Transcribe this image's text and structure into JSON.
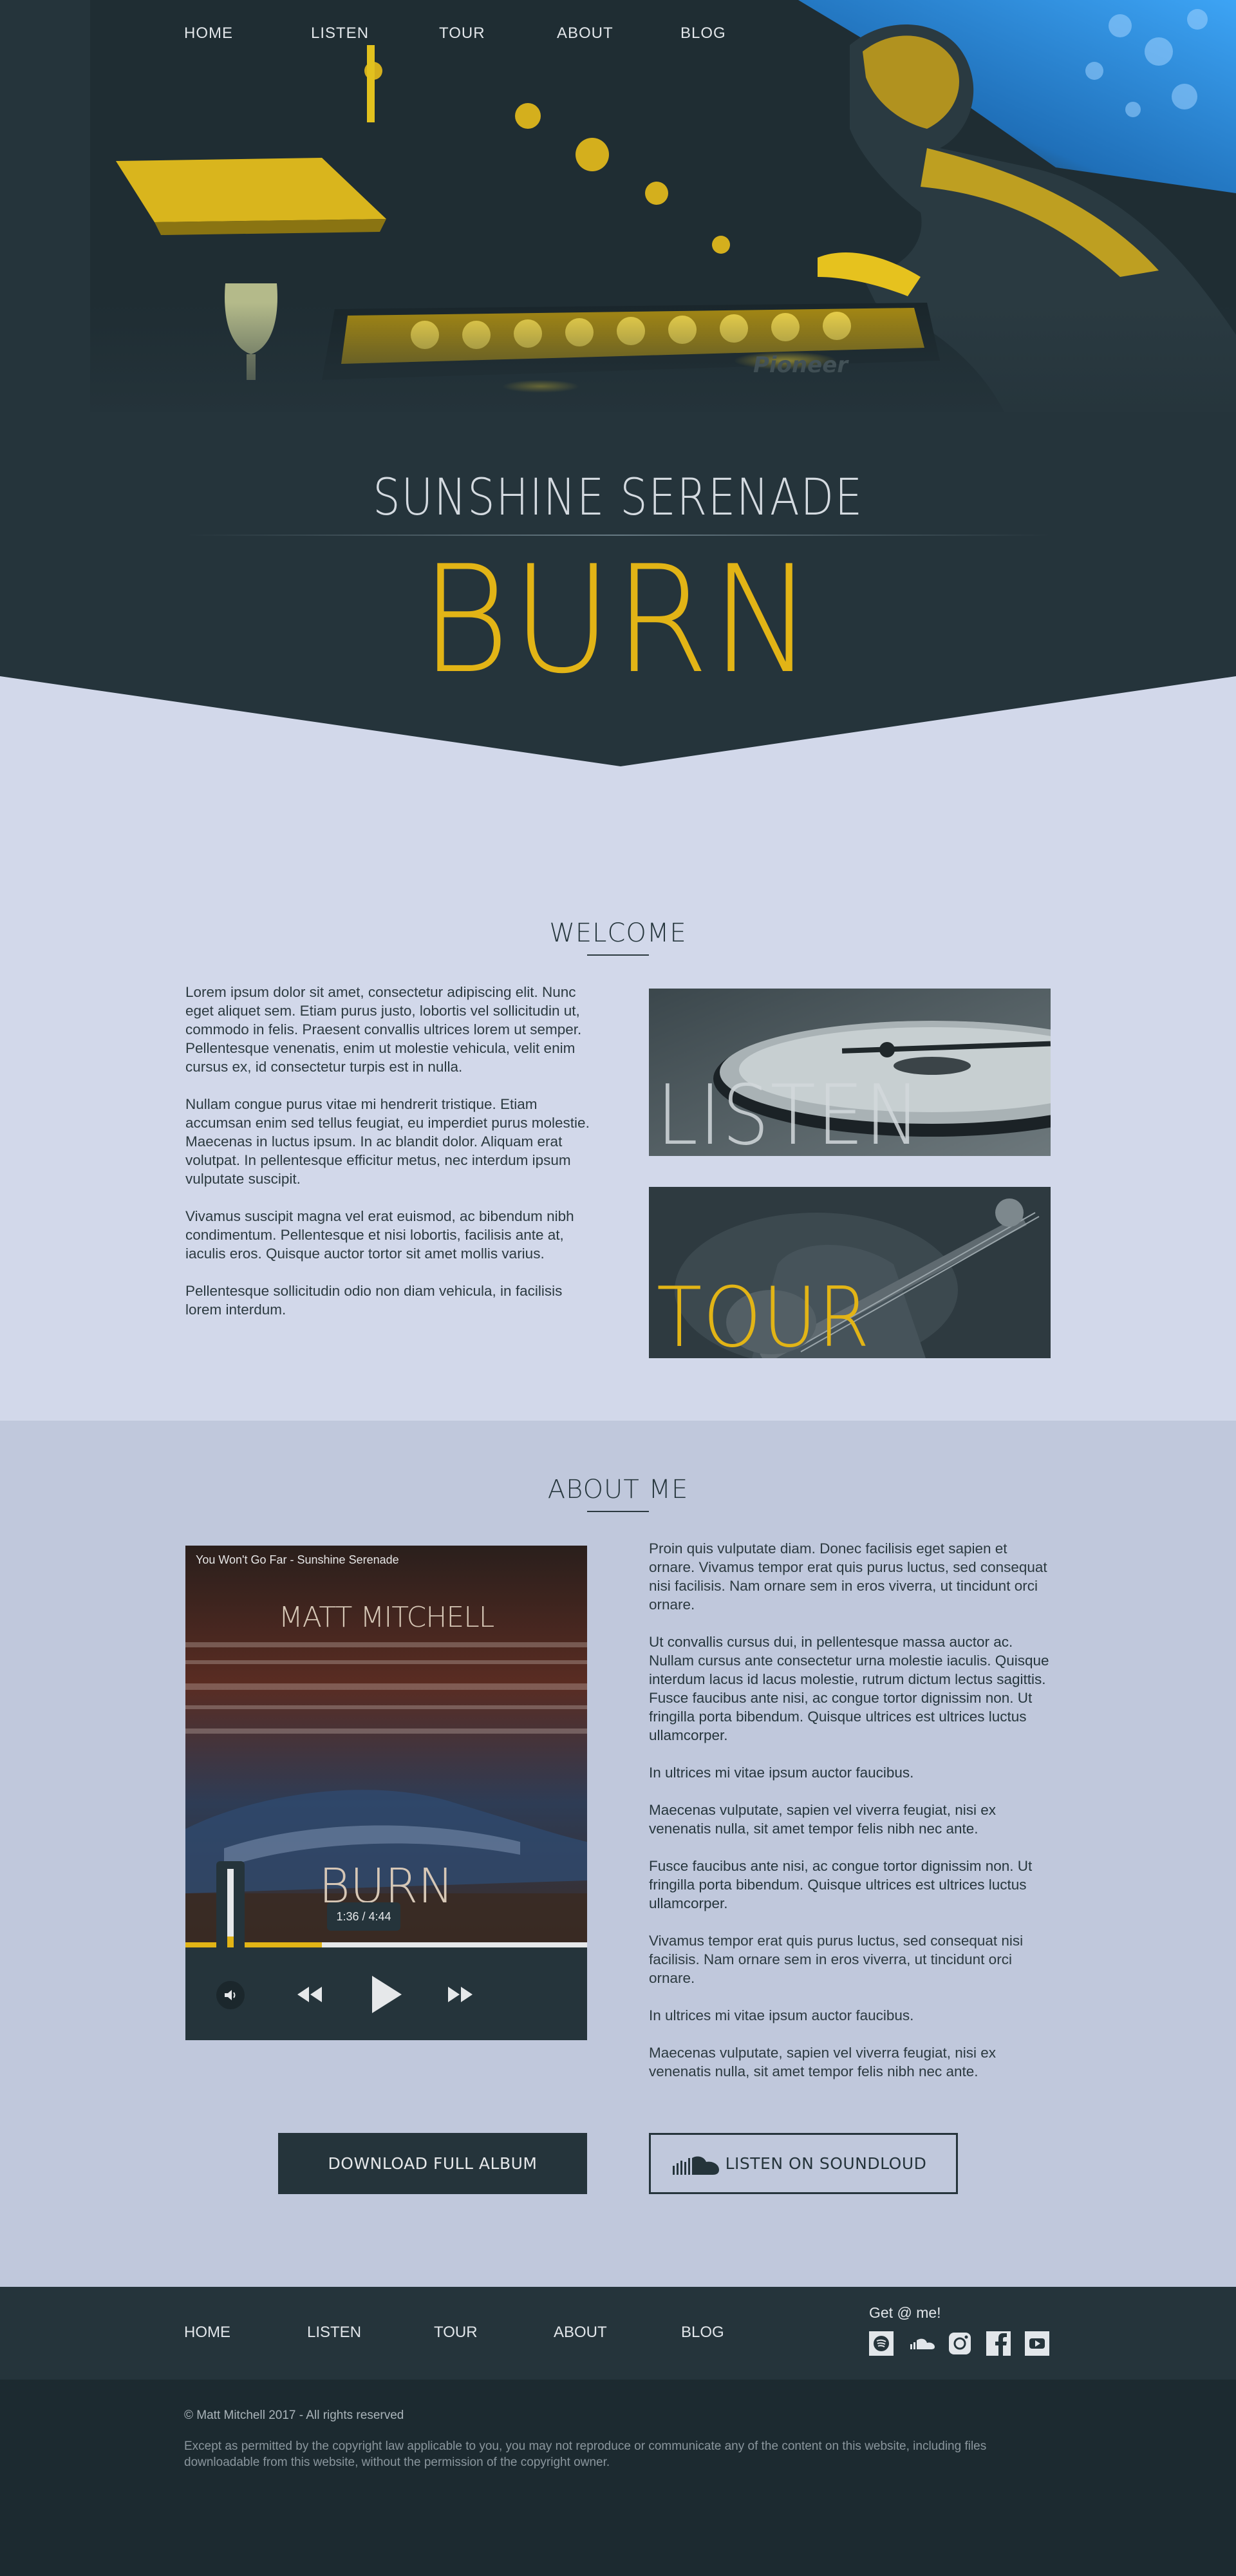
{
  "nav": {
    "items": [
      "HOME",
      "LISTEN",
      "TOUR",
      "ABOUT",
      "BLOG"
    ]
  },
  "hero": {
    "subtitle": "SUNSHINE SERENADE",
    "title": "BURN"
  },
  "welcome": {
    "title": "WELCOME",
    "paragraphs": [
      "Lorem ipsum dolor sit amet, consectetur adipiscing elit. Nunc eget aliquet sem. Etiam purus justo, lobortis vel sollicitudin ut, commodo in felis. Praesent convallis ultrices lorem ut semper. Pellentesque venenatis, enim ut molestie vehicula, velit enim cursus ex, id consectetur turpis est in nulla.",
      "Nullam congue purus vitae mi hendrerit tristique. Etiam accumsan enim sed tellus feugiat, eu imperdiet purus molestie. Maecenas in luctus ipsum. In ac blandit dolor. Aliquam erat volutpat. In pellentesque efficitur metus, nec interdum ipsum vulputate suscipit.",
      "Vivamus suscipit magna vel erat euismod, ac bibendum nibh condimentum. Pellentesque et nisi lobortis, facilisis ante at, iaculis eros. Quisque auctor tortor sit amet mollis varius.",
      "Pellentesque sollicitudin odio non diam vehicula, in facilisis lorem interdum."
    ],
    "tiles": {
      "listen": "LISTEN",
      "tour": "TOUR"
    }
  },
  "about": {
    "title": "ABOUT ME",
    "player": {
      "now_playing": "You Won't Go Far - Sunshine Serenade",
      "artist": "MATT MITCHELL",
      "album": "BURN",
      "time": "1:36 / 4:44",
      "progress": 0.34,
      "volume": 0.45
    },
    "paragraphs": [
      {
        "text": "Proin quis vulputate diam. Donec facilisis eget sapien et ornare. Vivamus tempor erat quis purus luctus, sed consequat nisi facilisis. Nam ornare sem in eros viverra, ut tincidunt orci ornare.",
        "dark": false
      },
      {
        "text": "Ut convallis cursus dui, in pellentesque massa auctor ac. Nullam cursus ante consectetur urna molestie iaculis. Quisque interdum lacus id lacus molestie, rutrum dictum lectus sagittis. Fusce faucibus ante nisi, ac congue tortor dignissim non. Ut fringilla porta bibendum. Quisque ultrices est ultrices luctus ullamcorper.",
        "dark": true
      },
      {
        "text": "In ultrices mi vitae ipsum auctor faucibus.",
        "dark": true
      },
      {
        "text": "Maecenas vulputate, sapien vel viverra feugiat, nisi ex venenatis nulla, sit amet tempor felis nibh nec ante.",
        "dark": true
      },
      {
        "text": "Fusce faucibus ante nisi, ac congue tortor dignissim non. Ut fringilla porta bibendum. Quisque ultrices est ultrices luctus ullamcorper.",
        "dark": true
      },
      {
        "text": "Vivamus tempor erat quis purus luctus, sed consequat nisi facilisis. Nam ornare sem in eros viverra, ut tincidunt orci ornare.",
        "dark": false
      },
      {
        "text": "In ultrices mi vitae ipsum auctor faucibus.",
        "dark": false
      },
      {
        "text": "Maecenas vulputate, sapien vel viverra feugiat, nisi ex venenatis nulla, sit amet tempor felis nibh nec ante.",
        "dark": false
      }
    ],
    "download_label": "DOWNLOAD FULL ALBUM",
    "soundcloud_label": "LISTEN ON SOUNDLOUD"
  },
  "footer": {
    "nav": [
      "HOME",
      "LISTEN",
      "TOUR",
      "ABOUT",
      "BLOG"
    ],
    "get_at_me": "Get @ me!",
    "social_icons": [
      "spotify-icon",
      "soundcloud-icon",
      "instagram-icon",
      "facebook-icon",
      "youtube-icon"
    ],
    "copyright": "© Matt Mitchell 2017 - All rights reserved",
    "legal": "Except as permitted by the copyright law applicable to you, you may not reproduce or communicate any of the content on this website, including files downloadable from this website, without the permission of the copyright owner."
  },
  "colors": {
    "accent": "#e2b416",
    "dark": "#25343b",
    "light_bg": "#d2d8ea",
    "about_bg": "#c0c8dc",
    "blue": "#2f8fe0"
  }
}
